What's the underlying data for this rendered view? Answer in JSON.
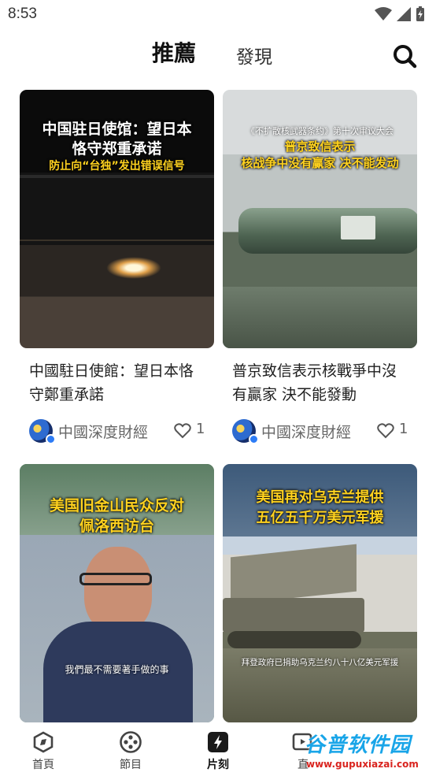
{
  "status_bar": {
    "time": "8:53"
  },
  "header": {
    "tabs": [
      {
        "label": "推薦",
        "active": true
      },
      {
        "label": "發現",
        "active": false
      }
    ]
  },
  "feed": [
    {
      "overlay_lines": [
        "中国驻日使馆：望日本",
        "恪守郑重承诺"
      ],
      "overlay_sub": "防止向“台独”发出错误信号",
      "title": "中國駐日使館：望日本恪守鄭重承諾",
      "author": "中國深度財經",
      "likes": "1"
    },
    {
      "overlay_top": "《不扩散核武器条约》第十次审议大会",
      "overlay_lines": [
        "普京致信表示",
        "核战争中没有赢家 决不能发动"
      ],
      "title": "普京致信表示核戰爭中沒有贏家 決不能發動",
      "author": "中國深度財經",
      "likes": "1"
    },
    {
      "overlay_lines": [
        "美国旧金山民众反对",
        "佩洛西访台"
      ],
      "subtitle": "我們最不需要著手做的事"
    },
    {
      "overlay_lines": [
        "美国再对乌克兰提供",
        "五亿五千万美元军援"
      ],
      "subtitle": "拜登政府已捐助乌克兰约八十八亿美元军援"
    }
  ],
  "bottom_nav": [
    {
      "label": "首頁",
      "icon": "home-compass-icon",
      "active": false
    },
    {
      "label": "節目",
      "icon": "film-reel-icon",
      "active": false
    },
    {
      "label": "片刻",
      "icon": "lightning-icon",
      "active": true
    },
    {
      "label": "直",
      "icon": "live-icon",
      "active": false
    }
  ],
  "watermark": {
    "main": "谷普软件园",
    "url": "www.gupuxiazai.com"
  },
  "colors": {
    "accent_yellow": "#ffd21f",
    "verified_blue": "#2d7cf6",
    "watermark_blue": "#19a5e8",
    "watermark_red": "#d9231e"
  }
}
